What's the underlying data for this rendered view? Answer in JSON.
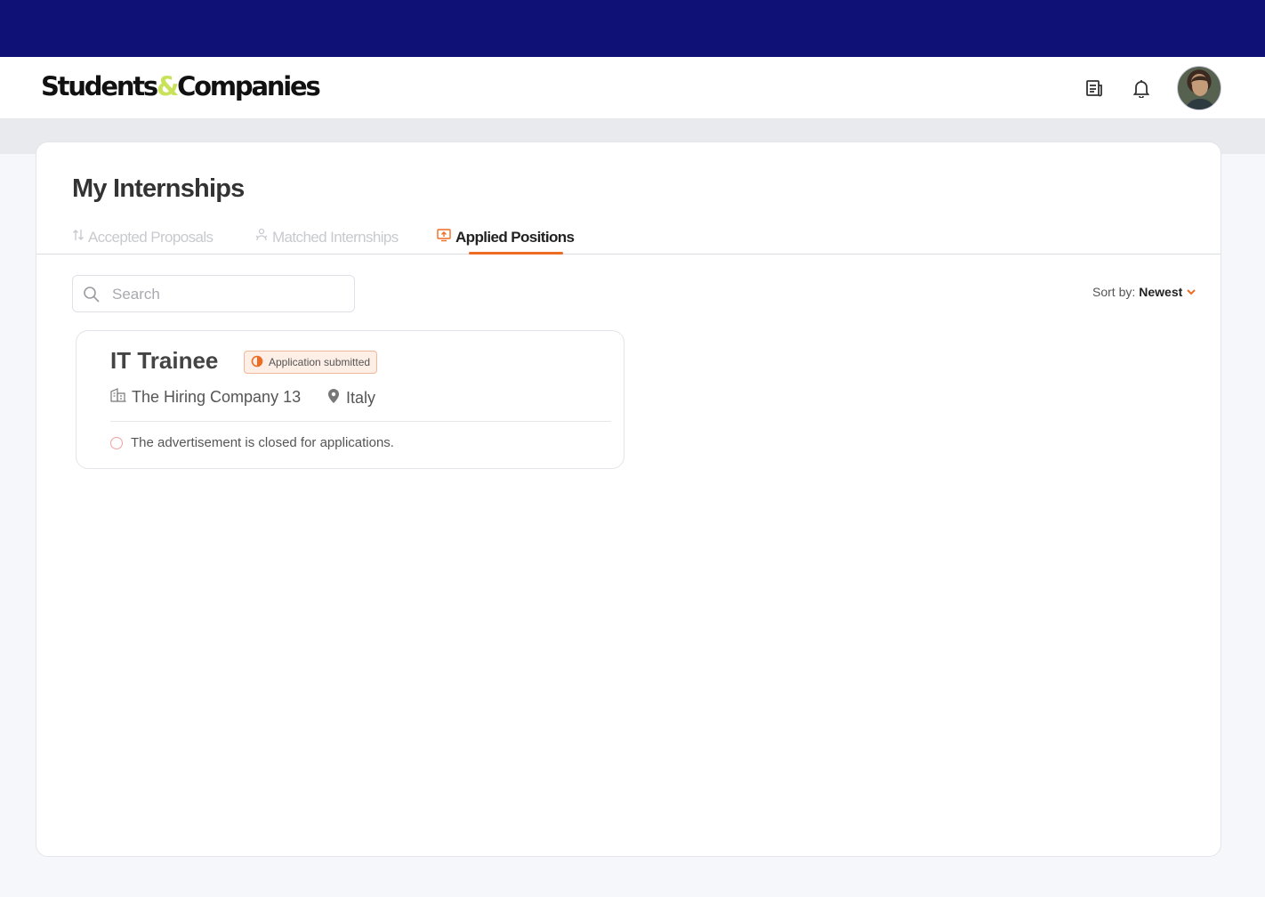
{
  "brand": {
    "part1": "Students",
    "amp": "&",
    "part2": "Companies"
  },
  "header": {
    "icons": [
      "news-icon",
      "bell-icon"
    ],
    "avatar": "user-avatar"
  },
  "page": {
    "title": "My Internships"
  },
  "tabs": [
    {
      "label": "Accepted Proposals",
      "icon": "swap-icon",
      "active": false
    },
    {
      "label": "Matched Internships",
      "icon": "match-icon",
      "active": false
    },
    {
      "label": "Applied Positions",
      "icon": "upload-screen-icon",
      "active": true
    }
  ],
  "search": {
    "placeholder": "Search",
    "value": ""
  },
  "sort": {
    "label": "Sort by:",
    "value": "Newest"
  },
  "results": [
    {
      "title": "IT Trainee",
      "status": "Application submitted",
      "company": "The Hiring Company 13",
      "location": "Italy",
      "notice": "The advertisement is closed for applications."
    }
  ],
  "colors": {
    "topbar": "#0f1177",
    "accent": "#ee6b24",
    "brand_amp": "#c8e35a"
  }
}
